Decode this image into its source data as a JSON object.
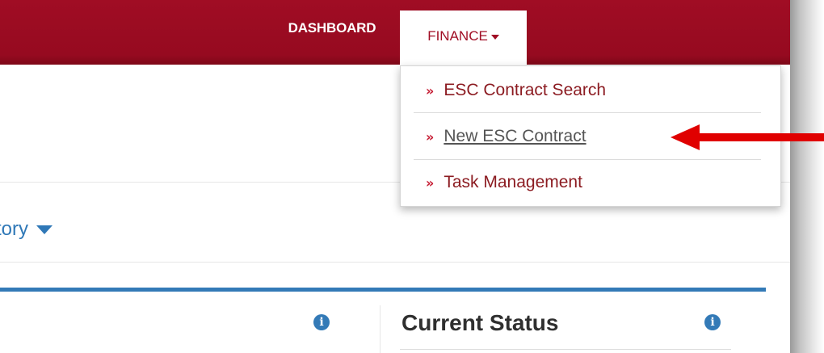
{
  "nav": {
    "dashboard_label": "DASHBOARD",
    "finance_label": "FINANCE"
  },
  "dropdown": {
    "items": [
      {
        "label": "ESC Contract Search",
        "bullet": "»"
      },
      {
        "label": "New ESC Contract",
        "bullet": "»"
      },
      {
        "label": "Task Management",
        "bullet": "»"
      }
    ]
  },
  "content": {
    "history_label": "tory",
    "current_status_title": "Current Status",
    "info_glyph": "i"
  },
  "colors": {
    "brand_red": "#a00d24",
    "link_blue": "#2f78b7",
    "panel_blue": "#337ab7",
    "annotation_arrow": "#e00000"
  }
}
